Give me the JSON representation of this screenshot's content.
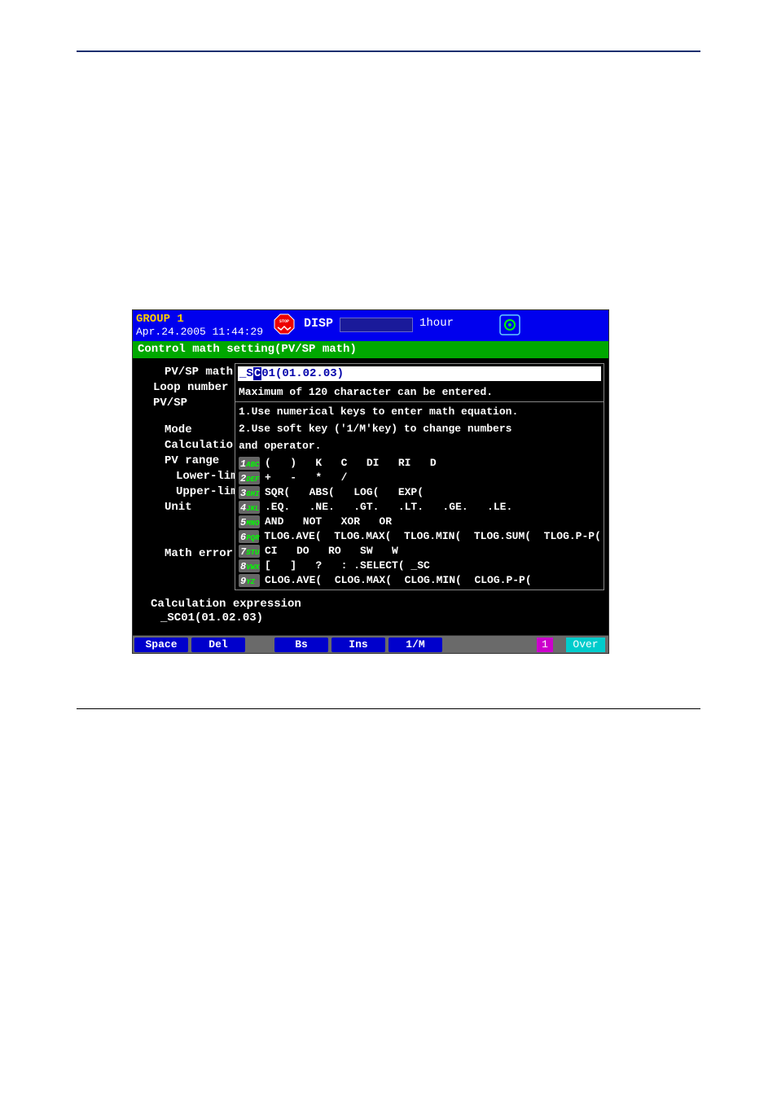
{
  "header": {
    "group": "GROUP 1",
    "datetime": "Apr.24.2005 11:44:29",
    "disp": "DISP",
    "period": "1hour"
  },
  "titlebar": "Control math setting(PV/SP math)",
  "left_panel": {
    "pvsp_math": "PV/SP math",
    "loop_number": "Loop number",
    "pvsp": "PV/SP",
    "mode": "Mode",
    "calculatio": "Calculatio",
    "pv_range": "PV range",
    "lower_lim": "Lower-lim",
    "upper_lim": "Upper-lim",
    "unit": "Unit",
    "math_error": "Math error"
  },
  "popup": {
    "input_prefix": "_S",
    "input_suffix": "C",
    "input_rest": "01(01.02.03)",
    "max_msg": "Maximum of 120 character can be entered.",
    "hint1": "1.Use numerical keys to enter math equation.",
    "hint2": "2.Use soft key ('1/M'key) to change numbers",
    "hint2b": "  and operator.",
    "keys": [
      {
        "num": "1",
        "sub": "ABC",
        "items": "(   )   K   C   DI   RI   D"
      },
      {
        "num": "2",
        "sub": "DEF",
        "items": "+   -   *   /"
      },
      {
        "num": "3",
        "sub": "GHI",
        "items": "SQR(   ABS(   LOG(   EXP("
      },
      {
        "num": "4",
        "sub": "JKL",
        "items": ".EQ.   .NE.   .GT.   .LT.   .GE.   .LE."
      },
      {
        "num": "5",
        "sub": "MNO",
        "items": "AND   NOT   XOR   OR"
      },
      {
        "num": "6",
        "sub": "PQR",
        "items": "TLOG.AVE(  TLOG.MAX(  TLOG.MIN(  TLOG.SUM(  TLOG.P-P("
      },
      {
        "num": "7",
        "sub": "STU",
        "items": "CI   DO   RO   SW   W"
      },
      {
        "num": "8",
        "sub": "VWX",
        "items": "[   ]   ?   : .SELECT( _SC"
      },
      {
        "num": "9",
        "sub": "YZ",
        "items": "CLOG.AVE(  CLOG.MAX(  CLOG.MIN(  CLOG.P-P("
      }
    ]
  },
  "calc_expression": {
    "label": "Calculation expression",
    "value": "_SC01(01.02.03)"
  },
  "softkeys": {
    "space": "Space",
    "del": "Del",
    "bs": "Bs",
    "ins": "Ins",
    "onem": "1/M",
    "slot": "1",
    "over": "Over"
  }
}
